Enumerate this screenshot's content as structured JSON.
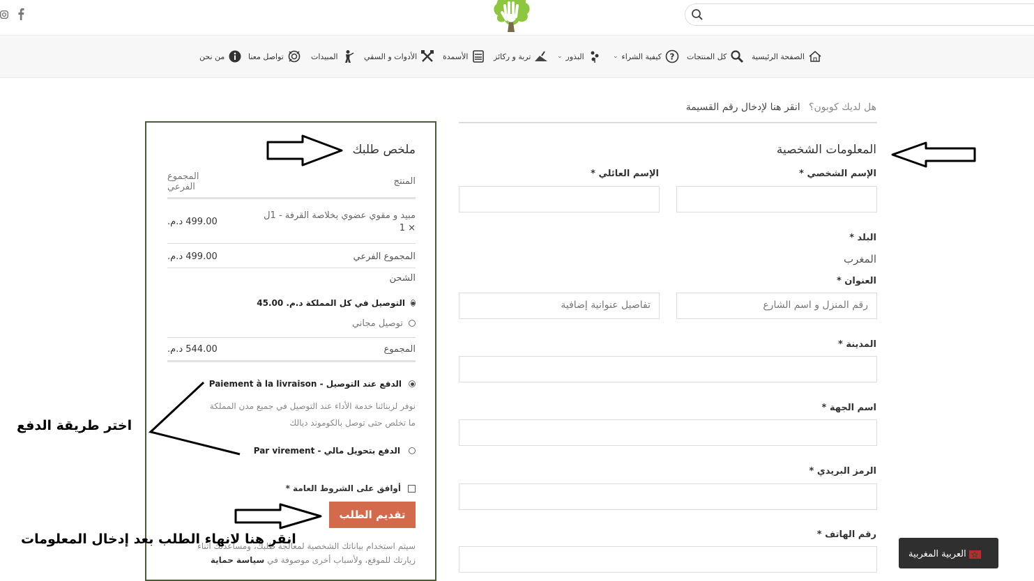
{
  "header": {
    "search": {
      "placeholder": ""
    },
    "social": [
      {
        "icon": "instagram-icon"
      },
      {
        "icon": "facebook-icon"
      }
    ],
    "logo_icon": "tree-hand-logo"
  },
  "nav": {
    "items": [
      {
        "label": "الصفحة الرئيسية",
        "icon": "home-icon"
      },
      {
        "label": "كل المنتجات",
        "icon": "magnifier-icon"
      },
      {
        "label": "كيفية الشراء",
        "icon": "question-icon",
        "dropdown": true
      },
      {
        "label": "البذور",
        "icon": "seeds-icon",
        "dropdown": true
      },
      {
        "label": "تربة و ركائز",
        "icon": "soil-icon"
      },
      {
        "label": "الأسمدة",
        "icon": "fertilizer-icon"
      },
      {
        "label": "الأدوات و السقي",
        "icon": "tools-icon"
      },
      {
        "label": "المبيدات",
        "icon": "sprayer-icon"
      },
      {
        "label": "تواصل معنا",
        "icon": "contact-icon"
      },
      {
        "label": "من نحن",
        "icon": "info-icon"
      }
    ]
  },
  "coupon": {
    "question": "هل لديك كوبون؟",
    "link": "انقر هنا لإدخال رقم القسيمة"
  },
  "billing": {
    "title": "المعلومات الشخصية",
    "first_name_label": "الإسم الشخصي *",
    "last_name_label": "الإسم العائلي *",
    "country_label": "البلد *",
    "country_value": "المغرب",
    "address_label": "العنوان *",
    "address_placeholder": "رقم المنزل و اسم الشارع",
    "address2_placeholder": "تفاصيل عنوانية إضافية",
    "city_label": "المدينة *",
    "region_label": "اسم الجهة *",
    "postcode_label": "الرمز البريدي *",
    "phone_label": "رقم الهاتف *"
  },
  "order": {
    "title": "ملخص طلبك",
    "col_product": "المنتج",
    "col_subtotal": "المجموع الفرعي",
    "item_name": "مبيد و مقوي عضوي بخلاصة القرفة - 1ل",
    "item_qty": "× 1",
    "item_price": "499.00 د.م.",
    "subtotal_label": "المجموع الفرعي",
    "subtotal_value": "499.00 د.م.",
    "shipping_label": "الشحن",
    "shipping_option1": "التوصيل في كل المملكة د.م. 45.00",
    "shipping_option2": "توصيل مجاني",
    "total_label": "المجموع",
    "total_value": "544.00 د.م.",
    "payment1": "الدفع عند التوصيل - Paiement à la livraison",
    "payment1_desc_line1": "نوفر لزبنائنا خدمة الأداء عند التوصيل في جميع مدن المملكة",
    "payment1_desc_line2": "ما تخلص حتى توصل بالكوموند ديالك",
    "payment2": "الدفع بتحويل مالي - Par virement",
    "terms": "أوافق على الشروط العامة *",
    "place_order": "تقديم الطلب",
    "privacy_line1": "سيتم استخدام بياناتك الشخصية لمعالجة طلبك، ومساعدتك أثناء",
    "privacy_line2": "زيارتك للموقع، ولأسباب أخرى موصوفة في",
    "privacy_link": "سياسة حماية"
  },
  "annotations": {
    "choose_payment": "اختر طريقة الدفع",
    "click_finish": "انقر هنا لانهاء الطلب بعد إدخال المعلومات"
  },
  "language": {
    "label": "العربية المغربية",
    "flag_icon": "morocco-flag-icon"
  },
  "colors": {
    "accent": "#d36a4b",
    "box_border": "#4a5a3a",
    "logo_green": "#8dc63f"
  }
}
